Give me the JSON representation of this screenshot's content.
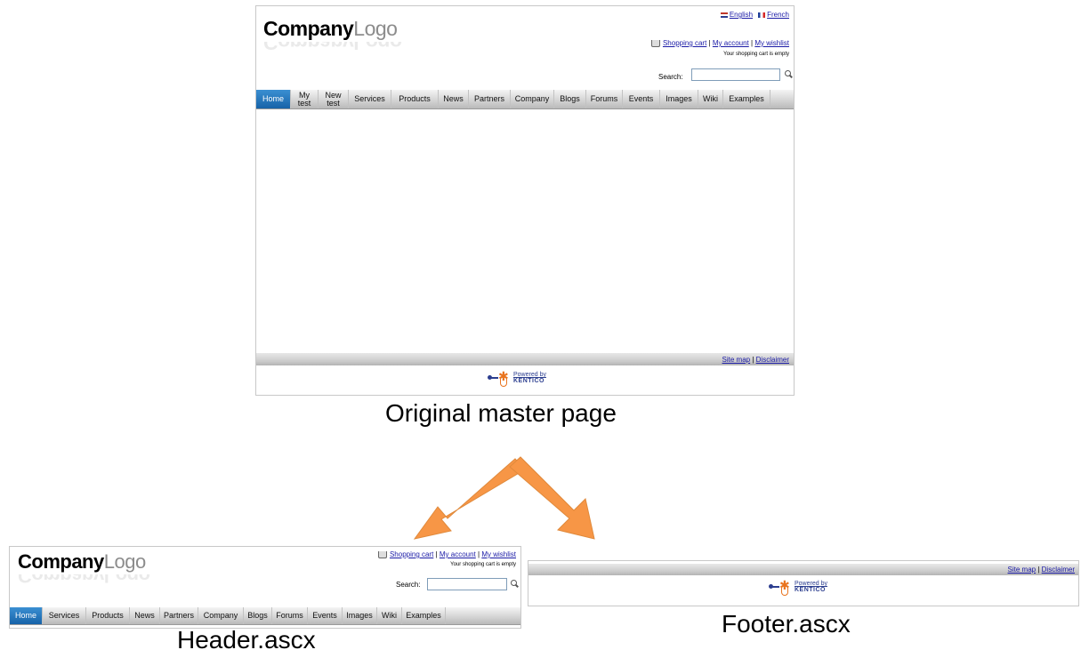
{
  "logo": {
    "company": "Company",
    "logo": "Logo"
  },
  "languages": [
    {
      "label": "English",
      "flag": "uk-flag-icon"
    },
    {
      "label": "French",
      "flag": "france-flag-icon"
    }
  ],
  "account_links": {
    "shopping_cart": "Shopping cart",
    "separator": "|",
    "my_account": "My account",
    "my_wishlist": "My wishlist",
    "cart_status": "Your shopping cart is empty"
  },
  "search": {
    "label": "Search:",
    "value": ""
  },
  "master_menu": [
    "Home",
    "My\ntest",
    "New\ntest",
    "Services",
    "Products",
    "News",
    "Partners",
    "Company",
    "Blogs",
    "Forums",
    "Events",
    "Images",
    "Wiki",
    "Examples"
  ],
  "header_menu": [
    "Home",
    "Services",
    "Products",
    "News",
    "Partners",
    "Company",
    "Blogs",
    "Forums",
    "Events",
    "Images",
    "Wiki",
    "Examples"
  ],
  "footer_links": {
    "site_map": "Site map",
    "separator": "|",
    "disclaimer": "Disclaimer"
  },
  "powered_by": {
    "line1": "Powered by",
    "line2": "KENTICO"
  },
  "captions": {
    "master": "Original master page",
    "header": "Header.ascx",
    "footer": "Footer.ascx"
  },
  "colors": {
    "arrow": "#f79646",
    "menu_active": "#1f6fb5",
    "link": "#1a1aa6"
  }
}
